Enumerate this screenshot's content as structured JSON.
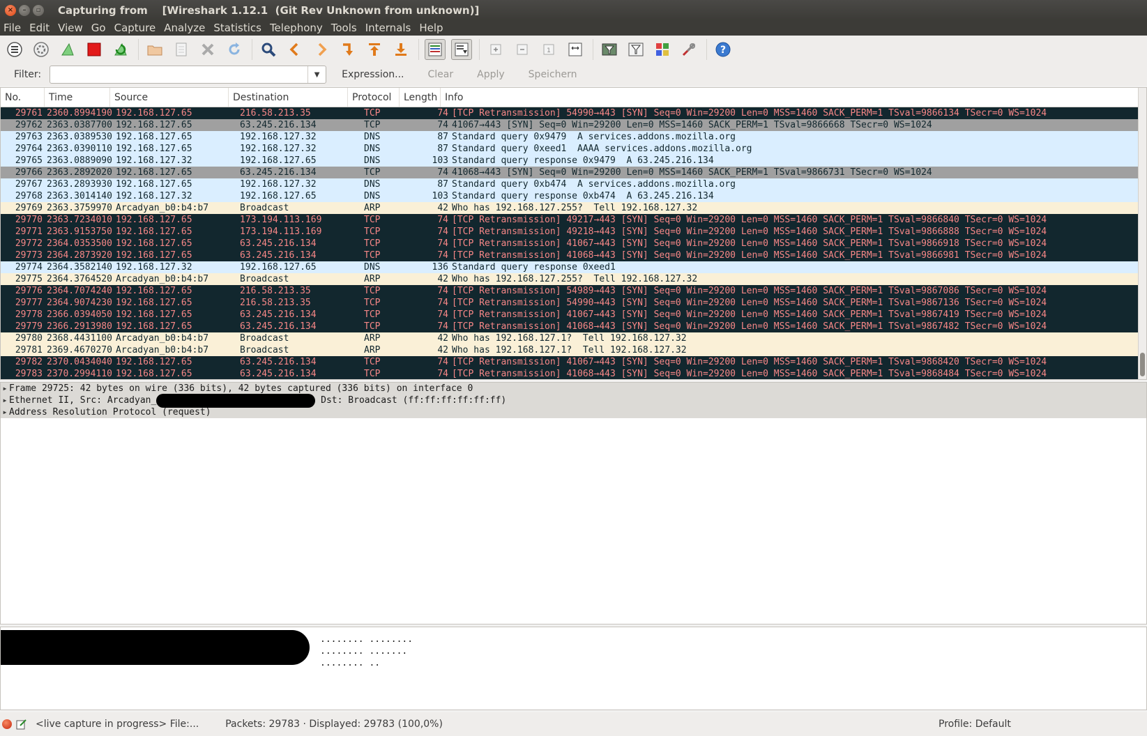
{
  "window": {
    "title": "Capturing from    [Wireshark 1.12.1  (Git Rev Unknown from unknown)]"
  },
  "menu": [
    "File",
    "Edit",
    "View",
    "Go",
    "Capture",
    "Analyze",
    "Statistics",
    "Telephony",
    "Tools",
    "Internals",
    "Help"
  ],
  "toolbar": {
    "icons": [
      "interfaces-icon",
      "options-icon",
      "start-capture-icon",
      "stop-capture-icon",
      "restart-capture-icon",
      "open-file-icon",
      "save-file-icon",
      "close-file-icon",
      "reload-icon",
      "find-packet-icon",
      "go-back-icon",
      "go-forward-icon",
      "go-to-packet-icon",
      "go-first-icon",
      "go-last-icon",
      "colorize-icon",
      "autoscroll-icon",
      "zoom-in-icon",
      "zoom-out-icon",
      "normal-size-icon",
      "resize-columns-icon",
      "capture-filters-icon",
      "display-filters-icon",
      "coloring-rules-icon",
      "preferences-icon",
      "help-icon"
    ]
  },
  "filter": {
    "label": "Filter:",
    "value": "",
    "expression": "Expression...",
    "clear": "Clear",
    "apply": "Apply",
    "save": "Speichern"
  },
  "packet_list": {
    "columns": [
      "No.",
      "Time",
      "Source",
      "Destination",
      "Protocol",
      "Length",
      "Info"
    ],
    "rows": [
      {
        "no": "29761",
        "time": "2360.8994190",
        "src": "192.168.127.65",
        "dst": "216.58.213.35",
        "proto": "TCP",
        "len": "74",
        "info": "[TCP Retransmission] 54990→443 [SYN] Seq=0 Win=29200 Len=0 MSS=1460 SACK_PERM=1 TSval=9866134 TSecr=0 WS=1024",
        "style": "bad"
      },
      {
        "no": "29762",
        "time": "2363.0387700",
        "src": "192.168.127.65",
        "dst": "63.245.216.134",
        "proto": "TCP",
        "len": "74",
        "info": "41067→443 [SYN] Seq=0 Win=29200 Len=0 MSS=1460 SACK_PERM=1 TSval=9866668 TSecr=0 WS=1024",
        "style": "tcp"
      },
      {
        "no": "29763",
        "time": "2363.0389530",
        "src": "192.168.127.65",
        "dst": "192.168.127.32",
        "proto": "DNS",
        "len": "87",
        "info": "Standard query 0x9479  A services.addons.mozilla.org",
        "style": "dns"
      },
      {
        "no": "29764",
        "time": "2363.0390110",
        "src": "192.168.127.65",
        "dst": "192.168.127.32",
        "proto": "DNS",
        "len": "87",
        "info": "Standard query 0xeed1  AAAA services.addons.mozilla.org",
        "style": "dns"
      },
      {
        "no": "29765",
        "time": "2363.0889090",
        "src": "192.168.127.32",
        "dst": "192.168.127.65",
        "proto": "DNS",
        "len": "103",
        "info": "Standard query response 0x9479  A 63.245.216.134",
        "style": "dns"
      },
      {
        "no": "29766",
        "time": "2363.2892020",
        "src": "192.168.127.65",
        "dst": "63.245.216.134",
        "proto": "TCP",
        "len": "74",
        "info": "41068→443 [SYN] Seq=0 Win=29200 Len=0 MSS=1460 SACK_PERM=1 TSval=9866731 TSecr=0 WS=1024",
        "style": "tcp"
      },
      {
        "no": "29767",
        "time": "2363.2893930",
        "src": "192.168.127.65",
        "dst": "192.168.127.32",
        "proto": "DNS",
        "len": "87",
        "info": "Standard query 0xb474  A services.addons.mozilla.org",
        "style": "dns"
      },
      {
        "no": "29768",
        "time": "2363.3014140",
        "src": "192.168.127.32",
        "dst": "192.168.127.65",
        "proto": "DNS",
        "len": "103",
        "info": "Standard query response 0xb474  A 63.245.216.134",
        "style": "dns"
      },
      {
        "no": "29769",
        "time": "2363.3759970",
        "src": "Arcadyan_b0:b4:b7",
        "dst": "Broadcast",
        "proto": "ARP",
        "len": "42",
        "info": "Who has 192.168.127.255?  Tell 192.168.127.32",
        "style": "arp"
      },
      {
        "no": "29770",
        "time": "2363.7234010",
        "src": "192.168.127.65",
        "dst": "173.194.113.169",
        "proto": "TCP",
        "len": "74",
        "info": "[TCP Retransmission] 49217→443 [SYN] Seq=0 Win=29200 Len=0 MSS=1460 SACK_PERM=1 TSval=9866840 TSecr=0 WS=1024",
        "style": "bad"
      },
      {
        "no": "29771",
        "time": "2363.9153750",
        "src": "192.168.127.65",
        "dst": "173.194.113.169",
        "proto": "TCP",
        "len": "74",
        "info": "[TCP Retransmission] 49218→443 [SYN] Seq=0 Win=29200 Len=0 MSS=1460 SACK_PERM=1 TSval=9866888 TSecr=0 WS=1024",
        "style": "bad"
      },
      {
        "no": "29772",
        "time": "2364.0353500",
        "src": "192.168.127.65",
        "dst": "63.245.216.134",
        "proto": "TCP",
        "len": "74",
        "info": "[TCP Retransmission] 41067→443 [SYN] Seq=0 Win=29200 Len=0 MSS=1460 SACK_PERM=1 TSval=9866918 TSecr=0 WS=1024",
        "style": "bad"
      },
      {
        "no": "29773",
        "time": "2364.2873920",
        "src": "192.168.127.65",
        "dst": "63.245.216.134",
        "proto": "TCP",
        "len": "74",
        "info": "[TCP Retransmission] 41068→443 [SYN] Seq=0 Win=29200 Len=0 MSS=1460 SACK_PERM=1 TSval=9866981 TSecr=0 WS=1024",
        "style": "bad"
      },
      {
        "no": "29774",
        "time": "2364.3582140",
        "src": "192.168.127.32",
        "dst": "192.168.127.65",
        "proto": "DNS",
        "len": "136",
        "info": "Standard query response 0xeed1",
        "style": "dns"
      },
      {
        "no": "29775",
        "time": "2364.3764520",
        "src": "Arcadyan_b0:b4:b7",
        "dst": "Broadcast",
        "proto": "ARP",
        "len": "42",
        "info": "Who has 192.168.127.255?  Tell 192.168.127.32",
        "style": "arp"
      },
      {
        "no": "29776",
        "time": "2364.7074240",
        "src": "192.168.127.65",
        "dst": "216.58.213.35",
        "proto": "TCP",
        "len": "74",
        "info": "[TCP Retransmission] 54989→443 [SYN] Seq=0 Win=29200 Len=0 MSS=1460 SACK_PERM=1 TSval=9867086 TSecr=0 WS=1024",
        "style": "bad"
      },
      {
        "no": "29777",
        "time": "2364.9074230",
        "src": "192.168.127.65",
        "dst": "216.58.213.35",
        "proto": "TCP",
        "len": "74",
        "info": "[TCP Retransmission] 54990→443 [SYN] Seq=0 Win=29200 Len=0 MSS=1460 SACK_PERM=1 TSval=9867136 TSecr=0 WS=1024",
        "style": "bad"
      },
      {
        "no": "29778",
        "time": "2366.0394050",
        "src": "192.168.127.65",
        "dst": "63.245.216.134",
        "proto": "TCP",
        "len": "74",
        "info": "[TCP Retransmission] 41067→443 [SYN] Seq=0 Win=29200 Len=0 MSS=1460 SACK_PERM=1 TSval=9867419 TSecr=0 WS=1024",
        "style": "bad"
      },
      {
        "no": "29779",
        "time": "2366.2913980",
        "src": "192.168.127.65",
        "dst": "63.245.216.134",
        "proto": "TCP",
        "len": "74",
        "info": "[TCP Retransmission] 41068→443 [SYN] Seq=0 Win=29200 Len=0 MSS=1460 SACK_PERM=1 TSval=9867482 TSecr=0 WS=1024",
        "style": "bad"
      },
      {
        "no": "29780",
        "time": "2368.4431100",
        "src": "Arcadyan_b0:b4:b7",
        "dst": "Broadcast",
        "proto": "ARP",
        "len": "42",
        "info": "Who has 192.168.127.1?  Tell 192.168.127.32",
        "style": "arp"
      },
      {
        "no": "29781",
        "time": "2369.4670270",
        "src": "Arcadyan_b0:b4:b7",
        "dst": "Broadcast",
        "proto": "ARP",
        "len": "42",
        "info": "Who has 192.168.127.1?  Tell 192.168.127.32",
        "style": "arp"
      },
      {
        "no": "29782",
        "time": "2370.0434040",
        "src": "192.168.127.65",
        "dst": "63.245.216.134",
        "proto": "TCP",
        "len": "74",
        "info": "[TCP Retransmission] 41067→443 [SYN] Seq=0 Win=29200 Len=0 MSS=1460 SACK_PERM=1 TSval=9868420 TSecr=0 WS=1024",
        "style": "bad"
      },
      {
        "no": "29783",
        "time": "2370.2994110",
        "src": "192.168.127.65",
        "dst": "63.245.216.134",
        "proto": "TCP",
        "len": "74",
        "info": "[TCP Retransmission] 41068→443 [SYN] Seq=0 Win=29200 Len=0 MSS=1460 SACK_PERM=1 TSval=9868484 TSecr=0 WS=1024",
        "style": "bad"
      }
    ]
  },
  "details": {
    "frame": "Frame 29725: 42 bytes on wire (336 bits), 42 bytes captured (336 bits) on interface 0",
    "eth_prefix": "Ethernet II, Src: Arcadyan_",
    "eth_suffix": " Dst: Broadcast (ff:ff:ff:ff:ff:ff)",
    "arp": "Address Resolution Protocol (request)"
  },
  "bytes": {
    "ascii": [
      "........ ........",
      "........ .......",
      "........ .."
    ]
  },
  "status": {
    "capture": "<live capture in progress> File:...",
    "packets": "Packets: 29783 · Displayed: 29783 (100,0%)",
    "profile": "Profile: Default"
  },
  "colors": {
    "bad_bg": "#12272e",
    "bad_fg": "#f78787",
    "tcp_bg": "#a0a0a0",
    "dns_bg": "#daeeff",
    "arp_bg": "#faf0d7"
  }
}
